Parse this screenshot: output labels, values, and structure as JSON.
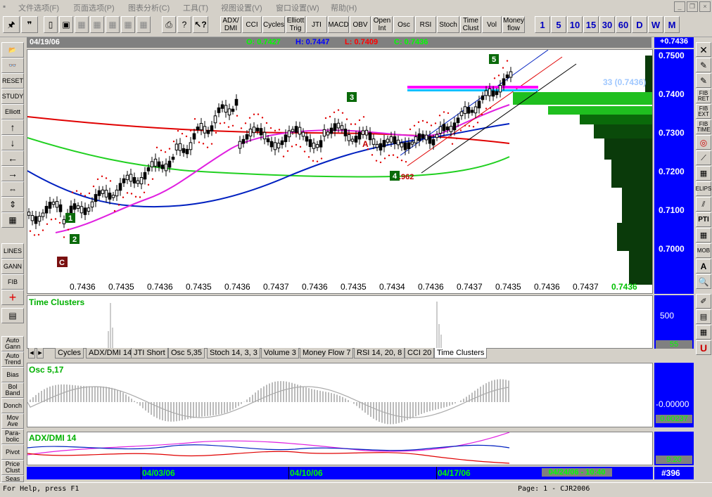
{
  "menu": [
    "文件选项(F)",
    "页面选项(P)",
    "图表分析(C)",
    "工具(T)",
    "视图设置(V)",
    "窗口设置(W)",
    "帮助(H)"
  ],
  "toolbar": {
    "indicators": [
      "ADX/\nDMI",
      "CCI",
      "Cycles",
      "Elliott\nTrig",
      "JTI",
      "MACD",
      "OBV",
      "Open\nInt",
      "Osc",
      "RSI",
      "Stoch",
      "Time\nClust",
      "Vol",
      "Money\nflow"
    ],
    "timeframes": [
      "1",
      "5",
      "10",
      "15",
      "30",
      "60",
      "D",
      "W",
      "M"
    ]
  },
  "infobar": {
    "date": "04/19/06",
    "open": "O: 0.7427",
    "high": "H: 0.7447",
    "low": "L: 0.7409",
    "close": "C: 0.7436"
  },
  "price_badge": "+0.7436",
  "price_axis": [
    "0.7500",
    "0.7400",
    "0.7300",
    "0.7200",
    "0.7100",
    "0.7000"
  ],
  "price_bottom": [
    "0.7436",
    "0.7435",
    "0.7436",
    "0.7435",
    "0.7436",
    "0.7437",
    "0.7436",
    "0.7435",
    "0.7434",
    "0.7436",
    "0.7437",
    "0.7435",
    "0.7436",
    "0.7437"
  ],
  "price_bottom_current": "0.7436",
  "chart_labels": {
    "wave_box_5": "5",
    "wave_box_3": "3",
    "wave_box_1": "1",
    "wave_box_2": "2",
    "wave_box_4": "4",
    "box_c": "C",
    "fib": ".962",
    "label_a": "A",
    "volprofile": "33 (0.7436)"
  },
  "left_buttons": [
    "📂",
    "",
    "RESET",
    "STUDY",
    "Elliott",
    "↑",
    "↓",
    "←",
    "→",
    "",
    "",
    "",
    "LINES",
    "GANN",
    "FIB",
    "+",
    "",
    "Auto\nGann",
    "Auto\nTrend",
    "Bias",
    "Bol\nBand",
    "Donch",
    "Mov\nAve",
    "Para-\nbolic",
    "Pivot",
    "Price\nClust",
    "Seas"
  ],
  "right_buttons": [
    "✕",
    "✎",
    "✎",
    "FIB\nRET",
    "FIB\nEXT",
    "FIB\nTIME",
    "",
    "",
    "",
    "ELIPS",
    "",
    "PTI",
    "",
    "MOB",
    "A",
    "🔍",
    "",
    "",
    "",
    "U"
  ],
  "time_clusters": {
    "title": "Time Clusters",
    "scale_top": "500",
    "scale_bottom": "55"
  },
  "tabs": [
    "Cycles",
    "ADX/DMI 14",
    "JTI Short",
    "Osc 5,35",
    "Stoch 14, 3, 3",
    "Volume 3",
    "Money Flow 7",
    "RSI 14, 20, 8",
    "CCI 20",
    "Time Clusters"
  ],
  "osc": {
    "title": "Osc 5,17",
    "scale_mid": "-0.00000",
    "scale_bottom": "0.00237"
  },
  "adx": {
    "title": "ADX/DMI 14",
    "scale_bottom": "9.20"
  },
  "datebar": {
    "dates": [
      "04/03/06",
      "04/10/06",
      "04/17/06"
    ],
    "current": "04/24/06 - 10:40",
    "bar_count": "#396"
  },
  "status": {
    "help": "For Help, press F1",
    "page": "Page: 1 - CJR2006"
  },
  "colors": {
    "scale_blue": "#0000ff",
    "green_label": "#00ff00",
    "ma_red": "#e00000",
    "ma_green": "#20d020",
    "ma_blue": "#0020c0",
    "ma_magenta": "#e020e0"
  }
}
